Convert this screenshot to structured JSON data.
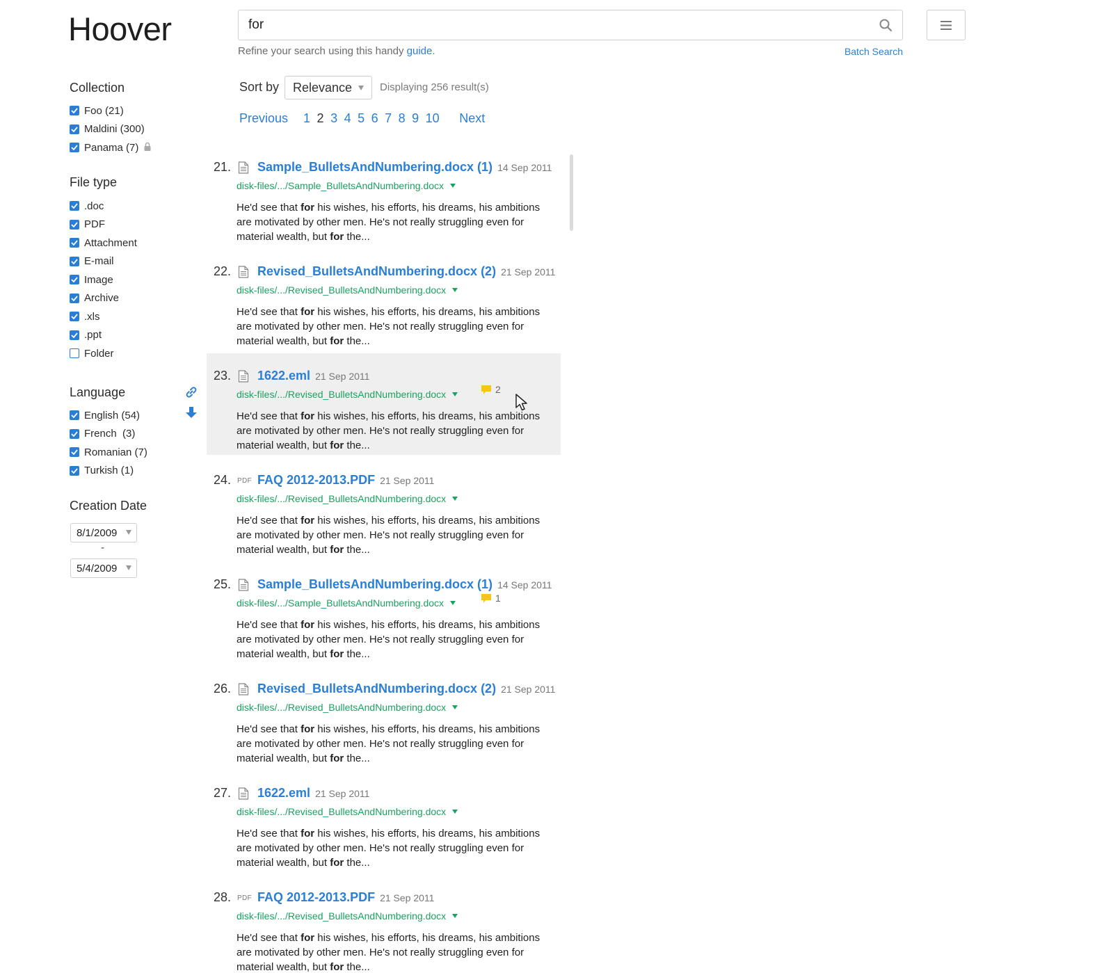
{
  "app": {
    "title": "Hoover"
  },
  "search": {
    "query": "for",
    "hint_prefix": "Refine your search using this handy",
    "hint_link": "guide.",
    "batch_label": "Batch Search"
  },
  "filters": {
    "collection": {
      "title": "Collection",
      "items": [
        {
          "label": "Foo (21)",
          "checked": true
        },
        {
          "label": "Maldini (300)",
          "checked": true
        },
        {
          "label": "Panama (7)",
          "checked": true,
          "locked": true
        }
      ]
    },
    "file_type": {
      "title": "File type",
      "items": [
        {
          "label": ".doc",
          "checked": true
        },
        {
          "label": "PDF",
          "checked": true
        },
        {
          "label": "Attachment",
          "checked": true
        },
        {
          "label": "E-mail",
          "checked": true
        },
        {
          "label": "Image",
          "checked": true
        },
        {
          "label": "Archive",
          "checked": true
        },
        {
          "label": ".xls",
          "checked": true
        },
        {
          "label": ".ppt",
          "checked": true
        },
        {
          "label": "Folder",
          "checked": false
        }
      ]
    },
    "language": {
      "title": "Language",
      "items": [
        {
          "label": "English (54)",
          "checked": true
        },
        {
          "label": "French  (3)",
          "checked": true
        },
        {
          "label": "Romanian (7)",
          "checked": true
        },
        {
          "label": "Turkish (1)",
          "checked": true
        }
      ]
    },
    "creation_date": {
      "title": "Creation Date",
      "from": "8/1/2009",
      "separator": "-",
      "to": "5/4/2009"
    }
  },
  "sort": {
    "label": "Sort by",
    "selected": "Relevance"
  },
  "result_count": "Displaying 256 result(s)",
  "pagination": {
    "previous": "Previous",
    "pages": [
      "1",
      "2",
      "3",
      "4",
      "5",
      "6",
      "7",
      "8",
      "9",
      "10"
    ],
    "current": "2",
    "next": "Next"
  },
  "snippet": {
    "part1": "He'd see that ",
    "bold": "for",
    "part2": " his wishes, his efforts, his dreams, his ambitions are motivated by other men. He's not really struggling even for material wealth, but ",
    "part3": " the..."
  },
  "results": [
    {
      "index": "21.",
      "title": "Sample_BulletsAndNumbering.docx (1)",
      "date": "14 Sep 2011",
      "path": "disk-files/.../Sample_BulletsAndNumbering.docx",
      "icon": "document-icon",
      "tags": ""
    },
    {
      "index": "22.",
      "title": "Revised_BulletsAndNumbering.docx (2)",
      "date": "21 Sep 2011",
      "path": "disk-files/.../Revised_BulletsAndNumbering.docx",
      "icon": "document-icon",
      "tags": ""
    },
    {
      "index": "23.",
      "title": "1622.eml",
      "date": "21 Sep 2011",
      "path": "disk-files/.../Revised_BulletsAndNumbering.docx",
      "icon": "document-icon",
      "tags": "2",
      "highlighted": true
    },
    {
      "index": "24.",
      "title": "FAQ 2012-2013.PDF",
      "date": "21 Sep 2011",
      "path": "disk-files/.../Revised_BulletsAndNumbering.docx",
      "icon": "pdf",
      "pdf_label": "PDF",
      "tags": ""
    },
    {
      "index": "25.",
      "title": "Sample_BulletsAndNumbering.docx (1)",
      "date": "14 Sep 2011",
      "path": "disk-files/.../Sample_BulletsAndNumbering.docx",
      "icon": "document-icon",
      "tags": "1"
    },
    {
      "index": "26.",
      "title": "Revised_BulletsAndNumbering.docx (2)",
      "date": "21 Sep 2011",
      "path": "disk-files/.../Revised_BulletsAndNumbering.docx",
      "icon": "document-icon",
      "tags": ""
    },
    {
      "index": "27.",
      "title": "1622.eml",
      "date": "21 Sep 2011",
      "path": "disk-files/.../Revised_BulletsAndNumbering.docx",
      "icon": "document-icon",
      "tags": ""
    },
    {
      "index": "28.",
      "title": "FAQ 2012-2013.PDF",
      "date": "21 Sep 2011",
      "path": "disk-files/.../Revised_BulletsAndNumbering.docx",
      "icon": "pdf",
      "pdf_label": "PDF",
      "tags": ""
    }
  ],
  "colors": {
    "accent": "#2a7fd4",
    "path_green": "#1aa260",
    "tag_yellow": "#f5c518",
    "highlight_bg": "#efefef"
  }
}
